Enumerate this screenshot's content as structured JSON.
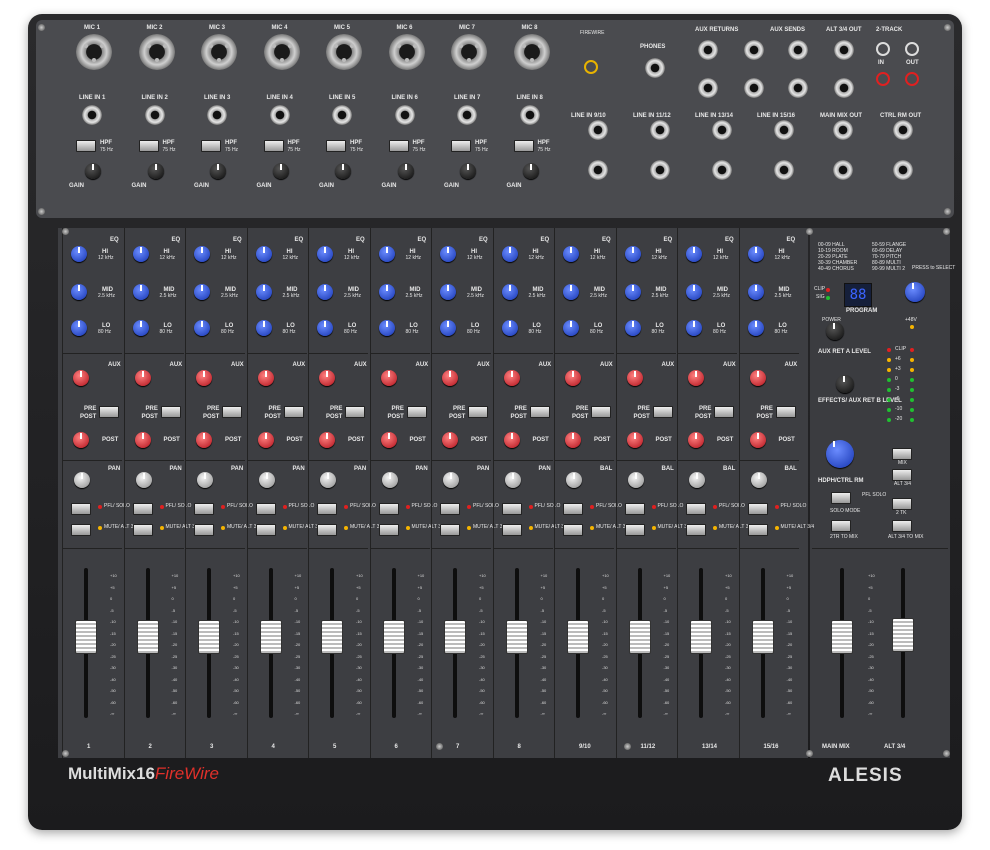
{
  "brand": {
    "model": "MultiMix16",
    "suffix": "FireWire",
    "maker": "ALESIS"
  },
  "top": {
    "mic_labels": [
      "MIC 1",
      "MIC 2",
      "MIC 3",
      "MIC 4",
      "MIC 5",
      "MIC 6",
      "MIC 7",
      "MIC 8"
    ],
    "line_labels": [
      "LINE IN 1",
      "LINE IN 2",
      "LINE IN 3",
      "LINE IN 4",
      "LINE IN 5",
      "LINE IN 6",
      "LINE IN 7",
      "LINE IN 8"
    ],
    "hpf": "HPF",
    "hpf_freq": "75 Hz",
    "gain": "GAIN",
    "phones": "PHONES",
    "firewire": "FIREWIRE",
    "aux_returns": "AUX RETURNS",
    "aux_sends": "AUX SENDS",
    "alt_out": "ALT 3/4 OUT",
    "two_track": "2-TRACK",
    "in": "IN",
    "out": "OUT",
    "stereo_line": [
      "LINE IN 9/10",
      "LINE IN 11/12",
      "LINE IN 13/14",
      "LINE IN 15/16"
    ],
    "main_mix_out": "MAIN MIX OUT",
    "ctrl_rm_out": "CTRL RM OUT",
    "L": "L",
    "R": "R",
    "A": "A",
    "B": "B",
    "ch3": "3",
    "ch4": "4"
  },
  "channel": {
    "eq": "EQ",
    "hi": "HI",
    "hi_freq": "12 kHz",
    "mid": "MID",
    "mid_freq": "2.5 kHz",
    "lo": "LO",
    "lo_freq": "80 Hz",
    "aux": "AUX",
    "pre": "PRE",
    "post": "POST",
    "pan": "PAN",
    "bal": "BAL",
    "pfl": "PFL/ SOLO",
    "mute": "MUTE/ ALT 3/4",
    "names": [
      "1",
      "2",
      "3",
      "4",
      "5",
      "6",
      "7",
      "8",
      "9/10",
      "11/12",
      "13/14",
      "15/16"
    ]
  },
  "fader_scale": [
    "+10",
    "+5",
    "0",
    "-5",
    "-10",
    "-15",
    "-20",
    "-25",
    "-30",
    "-40",
    "-50",
    "-60",
    "-∞"
  ],
  "master": {
    "fx_list_a": [
      "00-09 HALL",
      "10-19 ROOM",
      "20-29 PLATE",
      "30-39 CHAMBER",
      "40-49 CHORUS"
    ],
    "fx_list_b": [
      "50-59 FLANGE",
      "60-69 DELAY",
      "70-79 PITCH",
      "80-89 MULTI",
      "90-99 MULTI 2"
    ],
    "clip": "CLIP",
    "sig": "SIG",
    "display": "88",
    "program": "PROGRAM",
    "press": "PRESS to SELECT",
    "power": "POWER",
    "phantom": "+48V",
    "aux_ret_a": "AUX RET A LEVEL",
    "effects": "EFFECTS/ AUX RET B LEVEL",
    "meter_labels": [
      "CLIP",
      "+6",
      "+3",
      "0",
      "-3",
      "-6",
      "-10",
      "-20"
    ],
    "hdph": "HDPH/CTRL RM",
    "mix": "MIX",
    "alt34": "ALT 3/4",
    "two_tk": "2 TK",
    "pfl_solo": "PFL SOLO",
    "solo_mode": "SOLO MODE",
    "two_tr_to_mix": "2TR TO MIX",
    "alt_to_mix": "ALT 3/4 TO MIX",
    "main_mix": "MAIN MIX",
    "alt_fader": "ALT 3/4"
  }
}
